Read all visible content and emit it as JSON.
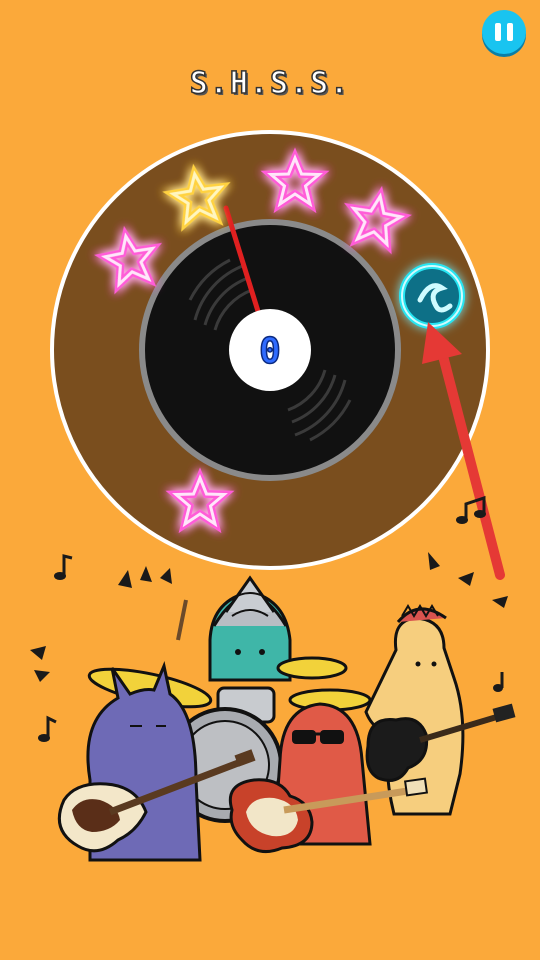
{
  "title": "S.H.S.S.",
  "score": "0",
  "pause_icon": "pause-icon",
  "colors": {
    "background": "#FBA93A",
    "ring": "#7A4E1E",
    "record": "#111111",
    "star_gold": "#FFD23F",
    "star_pink": "#FF5BD8",
    "target": "#25E5F2",
    "arrow": "#E53935",
    "pause": "#19C4F0"
  },
  "stars": [
    {
      "name": "star-gold",
      "color": "gold"
    },
    {
      "name": "star-pink-1",
      "color": "pink"
    },
    {
      "name": "star-pink-2",
      "color": "pink"
    },
    {
      "name": "star-pink-3",
      "color": "pink"
    },
    {
      "name": "star-pink-4",
      "color": "pink"
    }
  ],
  "target_icon": "music-note-target-icon",
  "band": [
    "purple-bassist",
    "teal-drummer",
    "red-guitarist",
    "yellow-guitarist"
  ]
}
